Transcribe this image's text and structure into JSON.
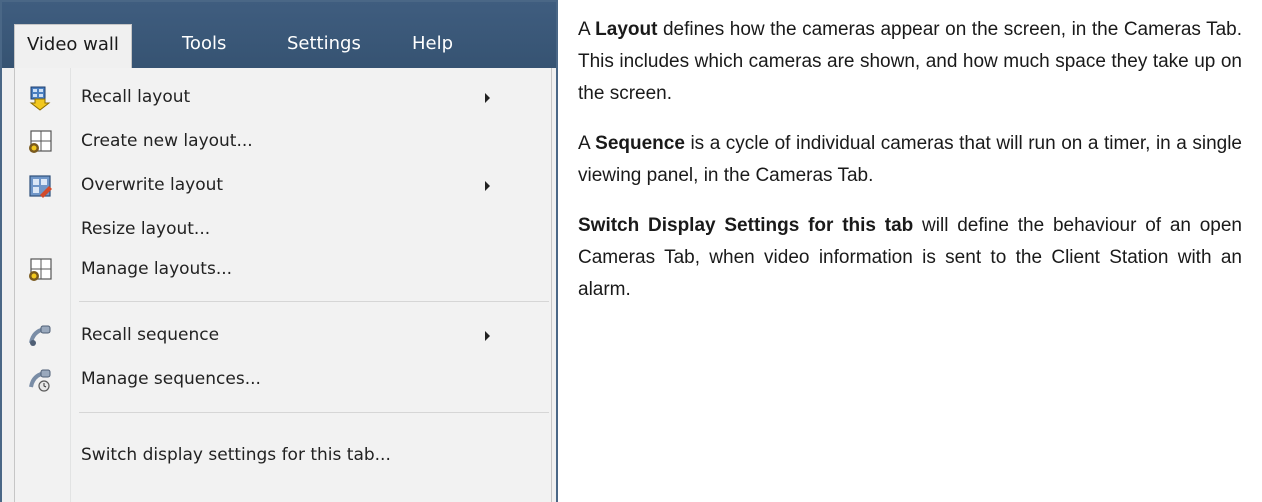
{
  "menubar": {
    "items": [
      {
        "label": "Video wall",
        "active": true
      },
      {
        "label": "Tools"
      },
      {
        "label": "Settings"
      },
      {
        "label": "Help"
      }
    ]
  },
  "menu": {
    "items": [
      {
        "label": "Recall layout",
        "icon": "recall-layout-icon",
        "submenu": true
      },
      {
        "label": "Create new layout...",
        "icon": "create-layout-icon",
        "submenu": false
      },
      {
        "label": "Overwrite layout",
        "icon": "overwrite-layout-icon",
        "submenu": true
      },
      {
        "label": "Resize layout...",
        "icon": null,
        "submenu": false
      },
      {
        "label": "Manage layouts...",
        "icon": "manage-layouts-icon",
        "submenu": false
      },
      {
        "label": "Recall sequence",
        "icon": "recall-sequence-icon",
        "submenu": true
      },
      {
        "label": "Manage sequences...",
        "icon": "manage-sequences-icon",
        "submenu": false
      },
      {
        "label": "Switch display settings for this tab...",
        "icon": null,
        "submenu": false
      }
    ]
  },
  "description": {
    "p1": {
      "pre": "A ",
      "bold": "Layout",
      "post": " defines how the cameras appear on the screen, in the Cameras Tab. This includes which cameras are shown, and how much space they take up on the screen."
    },
    "p2": {
      "pre": "A ",
      "bold": "Sequence",
      "post": " is a cycle of individual cameras that will run on a timer, in a single viewing panel, in the Cameras Tab."
    },
    "p3": {
      "pre": "",
      "bold": "Switch Display Settings for this tab",
      "post": " will define the behaviour of an open Cameras Tab, when video information is sent to the Client Station with an alarm."
    }
  }
}
